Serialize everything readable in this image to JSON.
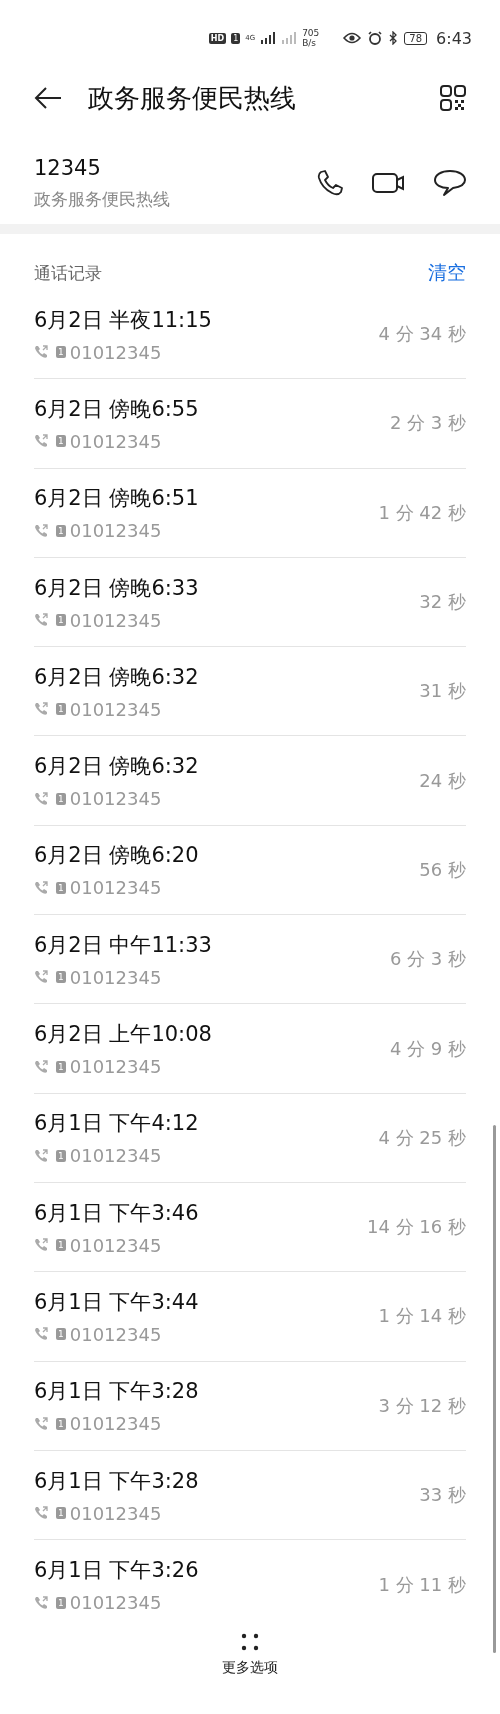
{
  "status_bar": {
    "hd": "HD",
    "sim": "1",
    "network": "4G",
    "speed": "705",
    "speed_unit": "B/s",
    "battery": "78",
    "time": "6:43"
  },
  "header": {
    "title": "政务服务便民热线"
  },
  "contact": {
    "number": "12345",
    "name": "政务服务便民热线"
  },
  "call_log": {
    "title": "通话记录",
    "clear": "清空",
    "calls": [
      {
        "time": "6月2日 半夜11:15",
        "sim": "1",
        "number": "01012345",
        "duration": "4 分 34 秒"
      },
      {
        "time": "6月2日 傍晚6:55",
        "sim": "1",
        "number": "01012345",
        "duration": "2 分 3 秒"
      },
      {
        "time": "6月2日 傍晚6:51",
        "sim": "1",
        "number": "01012345",
        "duration": "1 分 42 秒"
      },
      {
        "time": "6月2日 傍晚6:33",
        "sim": "1",
        "number": "01012345",
        "duration": "32 秒"
      },
      {
        "time": "6月2日 傍晚6:32",
        "sim": "1",
        "number": "01012345",
        "duration": "31 秒"
      },
      {
        "time": "6月2日 傍晚6:32",
        "sim": "1",
        "number": "01012345",
        "duration": "24 秒"
      },
      {
        "time": "6月2日 傍晚6:20",
        "sim": "1",
        "number": "01012345",
        "duration": "56 秒"
      },
      {
        "time": "6月2日 中午11:33",
        "sim": "1",
        "number": "01012345",
        "duration": "6 分 3 秒"
      },
      {
        "time": "6月2日 上午10:08",
        "sim": "1",
        "number": "01012345",
        "duration": "4 分 9 秒"
      },
      {
        "time": "6月1日 下午4:12",
        "sim": "1",
        "number": "01012345",
        "duration": "4 分 25 秒"
      },
      {
        "time": "6月1日 下午3:46",
        "sim": "1",
        "number": "01012345",
        "duration": "14 分 16 秒"
      },
      {
        "time": "6月1日 下午3:44",
        "sim": "1",
        "number": "01012345",
        "duration": "1 分 14 秒"
      },
      {
        "time": "6月1日 下午3:28",
        "sim": "1",
        "number": "01012345",
        "duration": "3 分 12 秒"
      },
      {
        "time": "6月1日 下午3:28",
        "sim": "1",
        "number": "01012345",
        "duration": "33 秒"
      },
      {
        "time": "6月1日 下午3:26",
        "sim": "1",
        "number": "01012345",
        "duration": "1 分 11 秒"
      }
    ]
  },
  "bottom_bar": {
    "more": "更多选项"
  }
}
